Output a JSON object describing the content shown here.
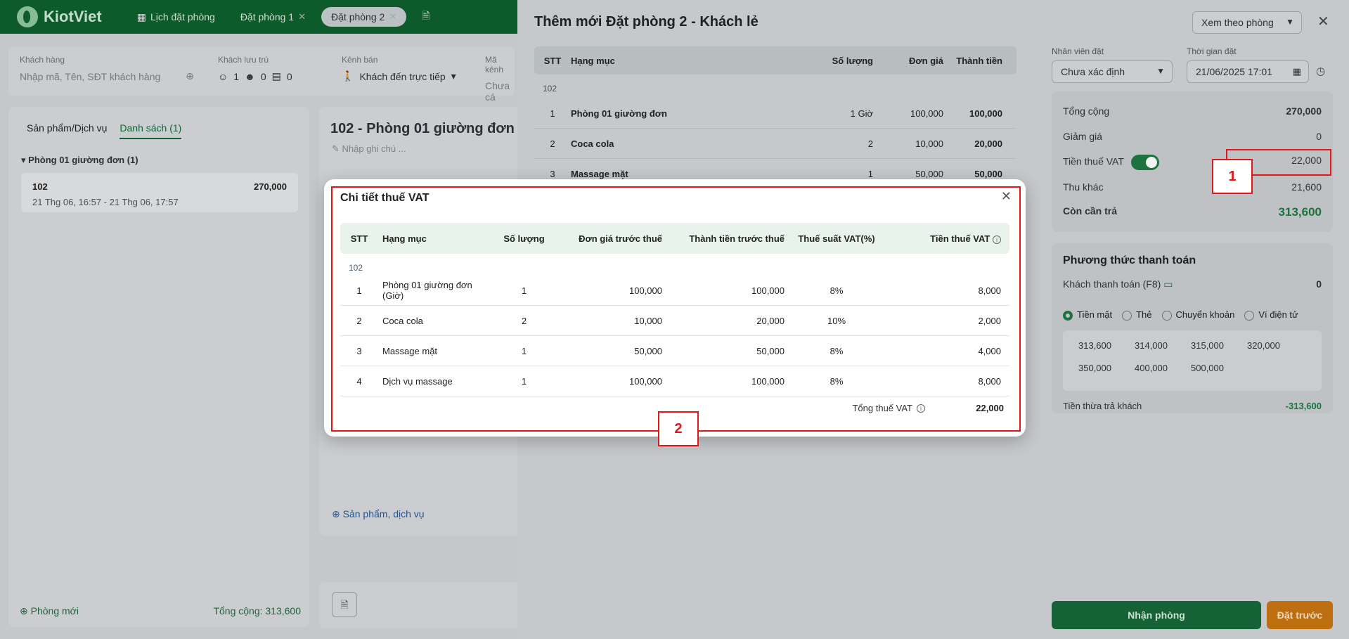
{
  "topbar": {
    "brand": "KiotViet",
    "tabs": [
      {
        "label": "Lịch đặt phòng"
      },
      {
        "label": "Đặt phòng 1"
      },
      {
        "label": "Đặt phòng 2"
      }
    ]
  },
  "infobar": {
    "customer_label": "Khách hàng",
    "customer_placeholder": "Nhập mã, Tên, SĐT khách hàng",
    "guests_label": "Khách lưu trú",
    "guests_adults": "1",
    "guests_children": "0",
    "guests_cards": "0",
    "channel_label": "Kênh bán",
    "channel_value": "Khách đến trực tiếp",
    "code_label": "Mã kênh",
    "code_value": "Chưa cá"
  },
  "left_panel": {
    "tabs": [
      "Sản phẩm/Dịch vụ",
      "Danh sách (1)"
    ],
    "group": "Phòng 01 giường đơn (1)",
    "card_room": "102",
    "card_amount": "270,000",
    "card_time": "21 Thg 06, 16:57 - 21 Thg 06, 17:57",
    "new_room": "Phòng mới",
    "total": "Tổng cộng: 313,600"
  },
  "mid_panel": {
    "title": "102 - Phòng 01 giường đơn",
    "note_placeholder": "Nhập ghi chú ...",
    "add_service": "Sản phẩm, dịch vụ"
  },
  "drawer": {
    "title": "Thêm mới Đặt phòng 2 - Khách lẻ",
    "view_select": "Xem theo phòng",
    "table_headers": [
      "STT",
      "Hạng mục",
      "Số lượng",
      "Đơn giá",
      "Thành tiền"
    ],
    "section": "102",
    "rows": [
      {
        "stt": "1",
        "name": "Phòng 01 giường đơn",
        "qty": "1 Giờ",
        "price": "100,000",
        "total": "100,000"
      },
      {
        "stt": "2",
        "name": "Coca cola",
        "qty": "2",
        "price": "10,000",
        "total": "20,000"
      },
      {
        "stt": "3",
        "name": "Massage mặt",
        "qty": "1",
        "price": "50,000",
        "total": "50,000"
      }
    ]
  },
  "right_panel": {
    "staff_label": "Nhân viên đặt",
    "staff_value": "Chưa xác định",
    "time_label": "Thời gian đặt",
    "time_value": "21/06/2025 17:01",
    "summary": {
      "total_label": "Tổng cộng",
      "total_value": "270,000",
      "discount_label": "Giảm giá",
      "discount_value": "0",
      "vat_label": "Tiền thuế VAT",
      "vat_value": "22,000",
      "other_label": "Thu khác",
      "other_value": "21,600",
      "due_label": "Còn cần trả",
      "due_value": "313,600"
    },
    "payment": {
      "title": "Phương thức thanh toán",
      "customer_pay_label": "Khách thanh toán (F8)",
      "customer_pay_value": "0",
      "methods": [
        "Tiền mặt",
        "Thẻ",
        "Chuyển khoản",
        "Ví điện tử"
      ],
      "amounts": [
        "313,600",
        "314,000",
        "315,000",
        "320,000",
        "350,000",
        "400,000",
        "500,000"
      ],
      "change_label": "Tiền thừa trả khách",
      "change_value": "-313,600"
    },
    "checkin_button": "Nhận phòng",
    "reserve_button": "Đặt trước"
  },
  "vat_modal": {
    "title": "Chi tiết thuế VAT",
    "headers": [
      "STT",
      "Hạng mục",
      "Số lượng",
      "Đơn giá trước thuế",
      "Thành tiền trước thuế",
      "Thuế suất VAT(%)",
      "Tiền thuế VAT"
    ],
    "section": "102",
    "rows": [
      {
        "stt": "1",
        "name": "Phòng 01 giường đơn  (Giờ)",
        "qty": "1",
        "price": "100,000",
        "subtotal": "100,000",
        "rate": "8%",
        "vat": "8,000"
      },
      {
        "stt": "2",
        "name": "Coca cola",
        "qty": "2",
        "price": "10,000",
        "subtotal": "20,000",
        "rate": "10%",
        "vat": "2,000"
      },
      {
        "stt": "3",
        "name": "Massage mặt",
        "qty": "1",
        "price": "50,000",
        "subtotal": "50,000",
        "rate": "8%",
        "vat": "4,000"
      },
      {
        "stt": "4",
        "name": "Dịch vụ massage",
        "qty": "1",
        "price": "100,000",
        "subtotal": "100,000",
        "rate": "8%",
        "vat": "8,000"
      }
    ],
    "total_label": "Tổng thuế VAT",
    "total_value": "22,000"
  },
  "annotations": {
    "marker1": "1",
    "marker2": "2",
    "color": "#e01818"
  }
}
